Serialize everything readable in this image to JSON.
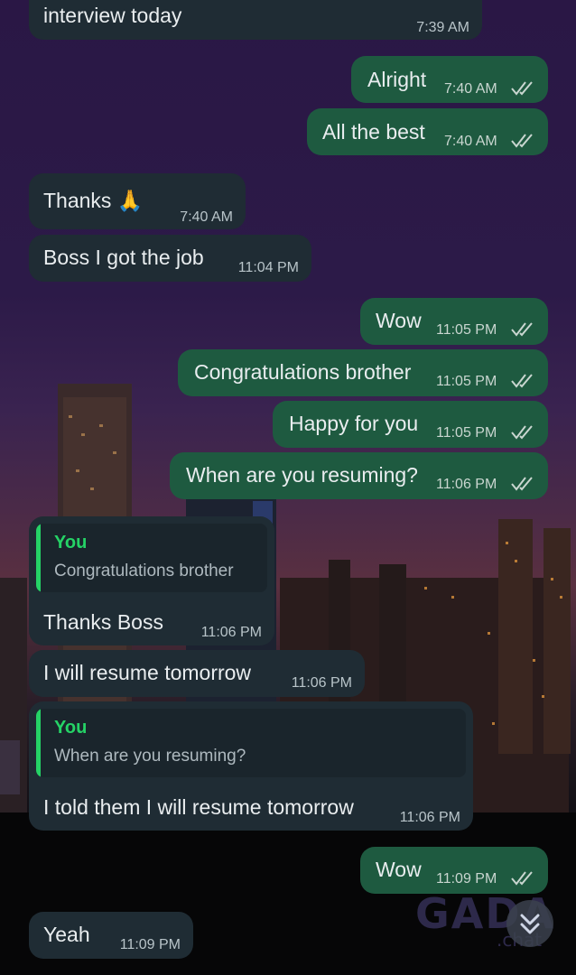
{
  "messages": [
    {
      "text": "interview today",
      "time": "7:39 AM"
    },
    {
      "text": "Alright",
      "time": "7:40 AM"
    },
    {
      "text": "All the best",
      "time": "7:40 AM"
    },
    {
      "text": "Thanks 🙏",
      "time": "7:40 AM"
    },
    {
      "text": "Boss I got the job",
      "time": "11:04 PM"
    },
    {
      "text": "Wow",
      "time": "11:05 PM"
    },
    {
      "text": "Congratulations brother",
      "time": "11:05 PM"
    },
    {
      "text": "Happy for you",
      "time": "11:05 PM"
    },
    {
      "text": "When are you resuming?",
      "time": "11:06 PM"
    },
    {
      "text": "Thanks Boss",
      "time": "11:06 PM",
      "quote_author": "You",
      "quote_text": "Congratulations brother"
    },
    {
      "text": "I will resume tomorrow",
      "time": "11:06 PM"
    },
    {
      "text": "I told them I will resume tomorrow",
      "time": "11:06 PM",
      "quote_author": "You",
      "quote_text": "When are you resuming?"
    },
    {
      "text": "Wow",
      "time": "11:09 PM"
    },
    {
      "text": "Yeah",
      "time": "11:09 PM"
    }
  ],
  "watermark": {
    "brand": "GADA",
    "sub": ".chat"
  },
  "icons": {
    "read_receipt": "double-check-icon",
    "scroll": "chevron-double-down-icon"
  },
  "colors": {
    "incoming": "#1f2c34",
    "outgoing": "#1e5a40",
    "accent": "#25d366"
  }
}
